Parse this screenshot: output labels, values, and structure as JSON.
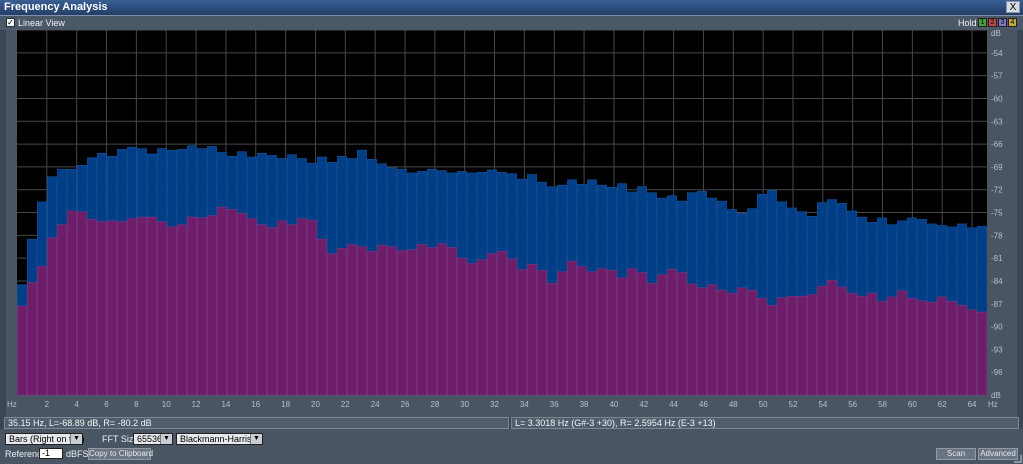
{
  "window": {
    "title": "Frequency Analysis",
    "close_label": "X"
  },
  "toolbar": {
    "linear_view_checked": "✓",
    "linear_view_label": "Linear View",
    "hold_label": "Hold",
    "hold_buttons": [
      {
        "label": "1",
        "color": "#4a9f3a"
      },
      {
        "label": "2",
        "color": "#c04646"
      },
      {
        "label": "3",
        "color": "#7f76c9"
      },
      {
        "label": "4",
        "color": "#c5a93c"
      }
    ]
  },
  "colors": {
    "left_channel": "#003f87",
    "right_channel": "#6e1d69",
    "grid": "#45484d",
    "plot_bg": "#000000"
  },
  "chart_data": {
    "type": "bar",
    "x_unit": "Hz",
    "y_unit": "dB",
    "x_ticks": [
      "2",
      "4",
      "6",
      "8",
      "10",
      "12",
      "14",
      "16",
      "18",
      "20",
      "22",
      "24",
      "26",
      "28",
      "30",
      "32",
      "34",
      "36",
      "38",
      "40",
      "42",
      "44",
      "46",
      "48",
      "50",
      "52",
      "54",
      "56",
      "58",
      "60",
      "62",
      "64"
    ],
    "y_ticks": [
      "-54",
      "-57",
      "-60",
      "-63",
      "-66",
      "-69",
      "-72",
      "-75",
      "-78",
      "-81",
      "-84",
      "-87",
      "-90",
      "-93",
      "-96"
    ],
    "ylim": [
      -99,
      -51
    ],
    "grid": true,
    "series": [
      {
        "channel": "L",
        "values": [
          -84.5,
          -78.5,
          -73.6,
          -70.3,
          -69.3,
          -69.3,
          -68.8,
          -67.8,
          -67.2,
          -67.6,
          -66.7,
          -66.4,
          -66.6,
          -67.3,
          -66.6,
          -66.8,
          -66.7,
          -66.2,
          -66.6,
          -66.3,
          -67.1,
          -67.6,
          -67.0,
          -67.7,
          -67.2,
          -67.5,
          -67.9,
          -67.4,
          -67.9,
          -68.5,
          -67.7,
          -68.4,
          -67.6,
          -67.9,
          -66.8,
          -68.0,
          -68.6,
          -69.1,
          -69.3,
          -69.8,
          -69.6,
          -69.3,
          -69.5,
          -69.8,
          -69.6,
          -69.8,
          -69.7,
          -69.4,
          -69.7,
          -69.9,
          -70.6,
          -70.0,
          -71.0,
          -71.6,
          -71.4,
          -70.7,
          -71.3,
          -70.7,
          -71.4,
          -71.7,
          -71.2,
          -72.3,
          -71.6,
          -72.4,
          -73.1,
          -72.8,
          -73.5,
          -72.4,
          -72.2,
          -73.1,
          -73.5,
          -74.6,
          -75.1,
          -74.5,
          -72.6,
          -72.1,
          -73.6,
          -74.4,
          -74.9,
          -75.5,
          -73.7,
          -73.3,
          -73.8,
          -74.8,
          -75.6,
          -76.3,
          -75.7,
          -76.6,
          -76.1,
          -75.7,
          -75.9,
          -76.5,
          -76.7,
          -76.9,
          -76.5,
          -77.0,
          -76.8
        ]
      },
      {
        "channel": "R",
        "values": [
          -87.3,
          -84.2,
          -82.1,
          -78.3,
          -76.6,
          -74.8,
          -74.9,
          -75.9,
          -76.2,
          -76.1,
          -76.2,
          -75.8,
          -75.6,
          -75.6,
          -76.2,
          -76.9,
          -76.6,
          -75.6,
          -75.7,
          -75.4,
          -74.3,
          -74.6,
          -75.1,
          -75.8,
          -76.6,
          -77.0,
          -76.1,
          -76.6,
          -75.8,
          -76.0,
          -78.5,
          -80.4,
          -79.7,
          -79.2,
          -79.5,
          -80.1,
          -79.3,
          -79.5,
          -80.0,
          -79.9,
          -79.2,
          -79.6,
          -79.1,
          -79.6,
          -81.0,
          -81.7,
          -81.2,
          -80.4,
          -80.1,
          -81.1,
          -82.5,
          -81.8,
          -82.6,
          -84.3,
          -82.8,
          -81.4,
          -82.1,
          -82.8,
          -82.4,
          -82.6,
          -83.6,
          -82.4,
          -82.9,
          -84.3,
          -83.2,
          -82.5,
          -82.9,
          -84.4,
          -84.9,
          -84.5,
          -85.2,
          -85.6,
          -84.9,
          -85.2,
          -86.3,
          -87.2,
          -86.2,
          -86.0,
          -86.0,
          -85.8,
          -84.7,
          -83.9,
          -84.8,
          -85.6,
          -86.0,
          -85.6,
          -86.7,
          -86.1,
          -85.3,
          -86.3,
          -86.6,
          -86.8,
          -86.1,
          -86.7,
          -87.2,
          -87.8,
          -88.1
        ]
      }
    ]
  },
  "status": {
    "cursor": "35.15 Hz, L=-68.89 dB, R= -80.2 dB",
    "peak": "L= 3.3018 Hz (G#-3 +30), R= 2.5954 Hz (E-3 +13)"
  },
  "controls": {
    "display_mode": "Bars (Right on top)",
    "fft_size_label": "FFT Size",
    "fft_size": "65536",
    "window_function": "Blackmann-Harris",
    "reference_label": "Reference",
    "reference_value": "-1",
    "reference_unit": "dBFS",
    "copy_button": "Copy to Clipboard",
    "scan_button": "Scan",
    "advanced_button": "Advanced"
  }
}
